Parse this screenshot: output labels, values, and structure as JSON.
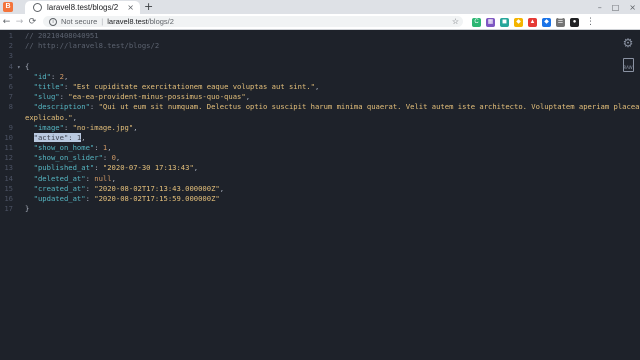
{
  "browser": {
    "tab": {
      "title": "laravel8.test/blogs/2",
      "close": "×"
    },
    "new_tab": "+",
    "window_controls": [
      "–",
      "□",
      "×"
    ],
    "nav": {
      "back": "←",
      "forward": "→",
      "reload": "⟳"
    },
    "omnibox": {
      "security": "Not secure",
      "separator": "|",
      "host": "laravel8.test",
      "path": "/blogs/2",
      "star": "☆"
    },
    "extensions": [
      {
        "name": "ext-green-c",
        "label": "C",
        "color": "#2bb673"
      },
      {
        "name": "ext-grid",
        "label": "▦",
        "color": "#7e57c2"
      },
      {
        "name": "ext-teal",
        "label": "◼",
        "color": "#26a69a"
      },
      {
        "name": "ext-yellow",
        "label": "◆",
        "color": "#f4b400"
      },
      {
        "name": "ext-red",
        "label": "▲",
        "color": "#e53935"
      },
      {
        "name": "ext-blue",
        "label": "◆",
        "color": "#1a73e8"
      },
      {
        "name": "ext-grey",
        "label": "☰",
        "color": "#757575"
      },
      {
        "name": "ext-dark",
        "label": "●",
        "color": "#202124"
      }
    ],
    "menu": "⋮"
  },
  "editor": {
    "lines": [
      {
        "n": "1",
        "parts": [
          {
            "c": "comment",
            "t": "// 20210408040951"
          }
        ]
      },
      {
        "n": "2",
        "parts": [
          {
            "c": "comment",
            "t": "// http://laravel8.test/blogs/2"
          }
        ]
      },
      {
        "n": "3",
        "parts": []
      },
      {
        "n": "4",
        "fold": "▾",
        "parts": [
          {
            "c": "punc",
            "t": "{"
          }
        ]
      },
      {
        "n": "5",
        "parts": [
          {
            "c": "txt",
            "t": "  "
          },
          {
            "c": "key",
            "t": "\"id\""
          },
          {
            "c": "punc",
            "t": ": "
          },
          {
            "c": "num",
            "t": "2"
          },
          {
            "c": "punc",
            "t": ","
          }
        ]
      },
      {
        "n": "6",
        "parts": [
          {
            "c": "txt",
            "t": "  "
          },
          {
            "c": "key",
            "t": "\"title\""
          },
          {
            "c": "punc",
            "t": ": "
          },
          {
            "c": "str",
            "t": "\"Est cupiditate exercitationem eaque voluptas aut sint.\""
          },
          {
            "c": "punc",
            "t": ","
          }
        ]
      },
      {
        "n": "7",
        "parts": [
          {
            "c": "txt",
            "t": "  "
          },
          {
            "c": "key",
            "t": "\"slug\""
          },
          {
            "c": "punc",
            "t": ": "
          },
          {
            "c": "str",
            "t": "\"ea-ea-provident-minus-possimus-quo-quas\""
          },
          {
            "c": "punc",
            "t": ","
          }
        ]
      },
      {
        "n": "8",
        "parts": [
          {
            "c": "txt",
            "t": "  "
          },
          {
            "c": "key",
            "t": "\"description\""
          },
          {
            "c": "punc",
            "t": ": "
          },
          {
            "c": "str",
            "t": "\"Qui ut eum sit numquam. Delectus optio suscipit harum minima quaerat. Velit autem iste architecto. Voluptatem aperiam placeat"
          }
        ]
      },
      {
        "n": "",
        "parts": [
          {
            "c": "str",
            "t": "explicabo.\""
          },
          {
            "c": "punc",
            "t": ","
          }
        ]
      },
      {
        "n": "9",
        "parts": [
          {
            "c": "txt",
            "t": "  "
          },
          {
            "c": "key",
            "t": "\"image\""
          },
          {
            "c": "punc",
            "t": ": "
          },
          {
            "c": "str",
            "t": "\"no-image.jpg\""
          },
          {
            "c": "punc",
            "t": ","
          }
        ]
      },
      {
        "n": "10",
        "parts": [
          {
            "c": "txt",
            "t": "  "
          },
          {
            "c": "sel",
            "t": "\"active\": 1"
          },
          {
            "c": "punc",
            "t": ","
          }
        ]
      },
      {
        "n": "11",
        "parts": [
          {
            "c": "txt",
            "t": "  "
          },
          {
            "c": "key",
            "t": "\"show_on_home\""
          },
          {
            "c": "punc",
            "t": ": "
          },
          {
            "c": "num",
            "t": "1"
          },
          {
            "c": "punc",
            "t": ","
          }
        ]
      },
      {
        "n": "12",
        "parts": [
          {
            "c": "txt",
            "t": "  "
          },
          {
            "c": "key",
            "t": "\"show_on_slider\""
          },
          {
            "c": "punc",
            "t": ": "
          },
          {
            "c": "num",
            "t": "0"
          },
          {
            "c": "punc",
            "t": ","
          }
        ]
      },
      {
        "n": "13",
        "parts": [
          {
            "c": "txt",
            "t": "  "
          },
          {
            "c": "key",
            "t": "\"published_at\""
          },
          {
            "c": "punc",
            "t": ": "
          },
          {
            "c": "str",
            "t": "\"2020-07-30 17:13:43\""
          },
          {
            "c": "punc",
            "t": ","
          }
        ]
      },
      {
        "n": "14",
        "parts": [
          {
            "c": "txt",
            "t": "  "
          },
          {
            "c": "key",
            "t": "\"deleted_at\""
          },
          {
            "c": "punc",
            "t": ": "
          },
          {
            "c": "lit",
            "t": "null"
          },
          {
            "c": "punc",
            "t": ","
          }
        ]
      },
      {
        "n": "15",
        "parts": [
          {
            "c": "txt",
            "t": "  "
          },
          {
            "c": "key",
            "t": "\"created_at\""
          },
          {
            "c": "punc",
            "t": ": "
          },
          {
            "c": "str",
            "t": "\"2020-08-02T17:13:43.000000Z\""
          },
          {
            "c": "punc",
            "t": ","
          }
        ]
      },
      {
        "n": "16",
        "parts": [
          {
            "c": "txt",
            "t": "  "
          },
          {
            "c": "key",
            "t": "\"updated_at\""
          },
          {
            "c": "punc",
            "t": ": "
          },
          {
            "c": "str",
            "t": "\"2020-08-02T17:15:59.000000Z\""
          }
        ]
      },
      {
        "n": "17",
        "parts": [
          {
            "c": "punc",
            "t": "}"
          }
        ]
      }
    ],
    "side": {
      "settings_icon": "⚙",
      "raw_label": "RAW"
    }
  }
}
